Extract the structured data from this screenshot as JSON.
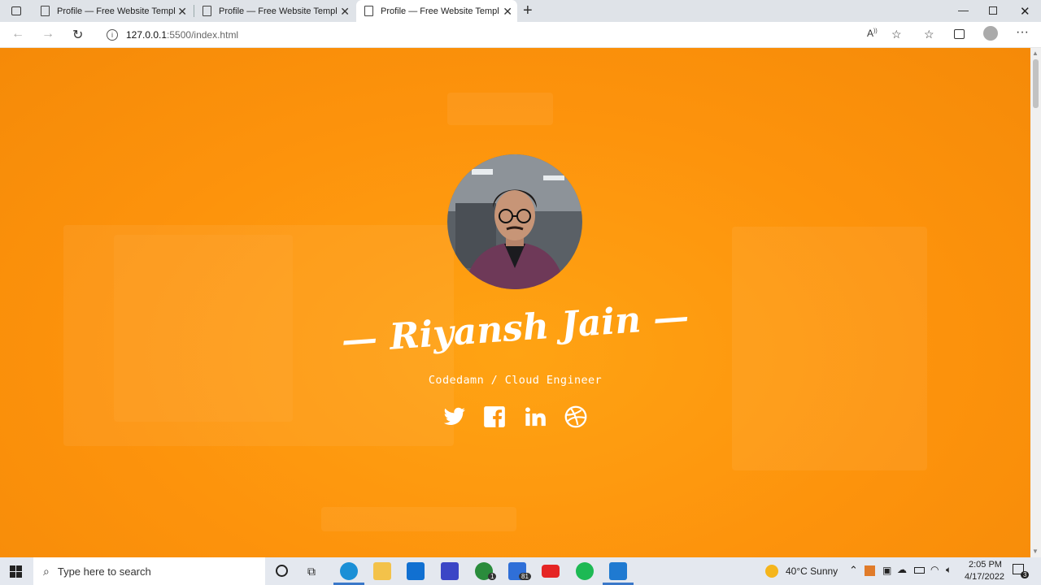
{
  "browser": {
    "tabs": [
      {
        "title": "Profile — Free Website Template",
        "active": false
      },
      {
        "title": "Profile — Free Website Template",
        "active": false
      },
      {
        "title": "Profile — Free Website Template",
        "active": true
      }
    ],
    "new_tab_glyph": "+",
    "url_host": "127.0.0.1",
    "url_rest": ":5500/index.html"
  },
  "page": {
    "background_color": "#fd930c",
    "name": "Riyansh Jain",
    "role": "Codedamn / Cloud Engineer",
    "social": [
      "twitter-icon",
      "facebook-icon",
      "linkedin-icon",
      "dribbble-icon"
    ]
  },
  "taskbar": {
    "search_placeholder": "Type here to search",
    "weather": "40°C  Sunny",
    "time": "2:05 PM",
    "date": "4/17/2022",
    "xbox_badge": "1",
    "store_badge": "81",
    "notification_count": "3"
  }
}
